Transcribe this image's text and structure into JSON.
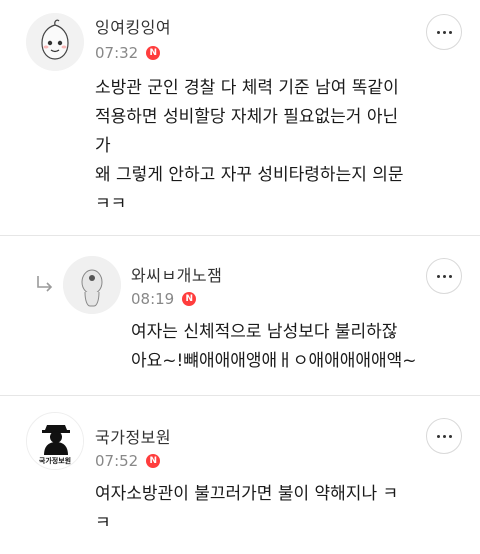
{
  "comments": [
    {
      "username": "잉여킹잉여",
      "time": "07:32",
      "badge": "N",
      "is_reply": false,
      "avatar_icon": "peach-character-avatar",
      "text": "소방관 군인 경찰 다 체력 기준 남여 똑같이\n적용하면 성비할당 자체가 필요없는거 아닌\n가\n왜 그렇게 안하고 자꾸 성비타령하는지 의문\nㅋㅋ"
    },
    {
      "username": "와씨ㅂ개노잼",
      "time": "08:19",
      "badge": "N",
      "is_reply": true,
      "avatar_icon": "cartoon-character-avatar",
      "text": "여자는 신체적으로 남성보다 불리하잖\n아요~!뺴애애애앵애ㅐㅇ애애애애애액~"
    },
    {
      "username": "국가정보원",
      "time": "07:52",
      "badge": "N",
      "is_reply": false,
      "avatar_icon": "spy-silhouette-avatar",
      "avatar_label": "국가정보원",
      "text": "여자소방관이 불끄러가면 불이 약해지나 ㅋ\nㅋ"
    }
  ],
  "colors": {
    "badge": "#ff3d3d",
    "time": "#888888",
    "divider": "#e6e6e6"
  }
}
